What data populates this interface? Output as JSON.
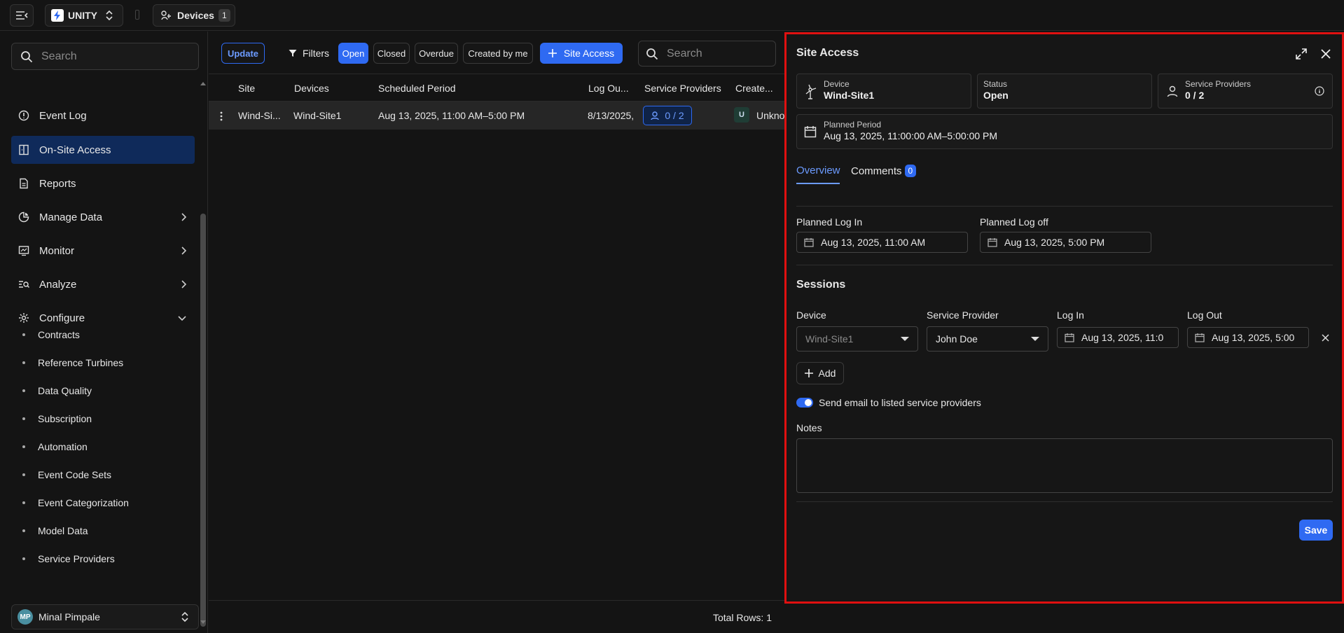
{
  "topbar": {
    "app_name": "UNITY",
    "devices_label": "Devices",
    "devices_count": "1"
  },
  "sidebar": {
    "search_placeholder": "Search",
    "items": [
      {
        "label": "Event Log",
        "icon": "alert-circle-icon"
      },
      {
        "label": "On-Site Access",
        "icon": "door-icon",
        "active": true
      },
      {
        "label": "Reports",
        "icon": "report-icon"
      },
      {
        "label": "Manage Data",
        "icon": "data-icon"
      },
      {
        "label": "Monitor",
        "icon": "monitor-icon"
      },
      {
        "label": "Analyze",
        "icon": "analyze-icon"
      },
      {
        "label": "Configure",
        "icon": "gear-icon"
      }
    ],
    "sub_items": [
      "Contracts",
      "Reference Turbines",
      "Data Quality",
      "Subscription",
      "Automation",
      "Event Code Sets",
      "Event Categorization",
      "Model Data",
      "Service Providers"
    ],
    "user": {
      "initials": "MP",
      "name": "Minal Pimpale"
    }
  },
  "toolbar": {
    "update": "Update",
    "filters": "Filters",
    "open": "Open",
    "closed": "Closed",
    "overdue": "Overdue",
    "created_by_me": "Created by me",
    "site_access": "Site Access",
    "search_placeholder": "Search"
  },
  "table": {
    "headers": [
      "Site",
      "Devices",
      "Scheduled Period",
      "Log Ou...",
      "Service Providers",
      "Create..."
    ],
    "row": {
      "site": "Wind-Si...",
      "devices": "Wind-Site1",
      "period": "Aug 13, 2025, 11:00 AM–5:00 PM",
      "logout": "8/13/2025,",
      "providers": "0 / 2",
      "created_initial": "U",
      "created": "Unkno"
    },
    "total_rows": "Total Rows: 1"
  },
  "panel": {
    "title": "Site Access",
    "device_label": "Device",
    "device_value": "Wind-Site1",
    "status_label": "Status",
    "status_value": "Open",
    "providers_label": "Service Providers",
    "providers_value": "0 / 2",
    "planned_period_label": "Planned Period",
    "planned_period_value": "Aug 13, 2025, 11:00:00 AM–5:00:00 PM",
    "tab_overview": "Overview",
    "tab_comments": "Comments",
    "comments_count": "0",
    "planned_log_in_label": "Planned Log In",
    "planned_log_in_value": "Aug 13, 2025, 11:00 AM",
    "planned_log_off_label": "Planned Log off",
    "planned_log_off_value": "Aug 13, 2025, 5:00 PM",
    "sessions_title": "Sessions",
    "col_device": "Device",
    "col_provider": "Service Provider",
    "col_login": "Log In",
    "col_logout": "Log Out",
    "session_device": "Wind-Site1",
    "session_provider": "John Doe",
    "session_login": "Aug 13, 2025, 11:0",
    "session_logout": "Aug 13, 2025, 5:00",
    "add_label": "Add",
    "email_toggle_label": "Send email to listed service providers",
    "notes_label": "Notes",
    "save_label": "Save"
  },
  "colors": {
    "accent": "#2f6af2",
    "highlight_border": "#e01010"
  }
}
